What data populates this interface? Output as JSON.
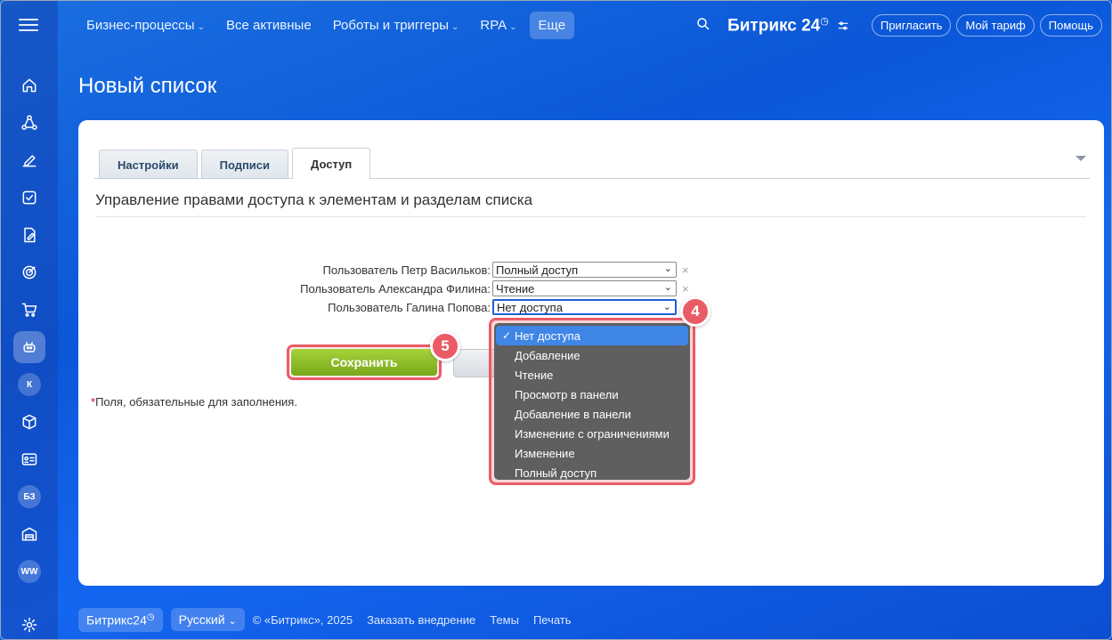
{
  "topbar": {
    "nav": [
      {
        "label": "Бизнес-процессы",
        "has_chevron": true
      },
      {
        "label": "Все активные",
        "has_chevron": false
      },
      {
        "label": "Роботы и триггеры",
        "has_chevron": true
      },
      {
        "label": "RPA",
        "has_chevron": true
      },
      {
        "label": "Еще",
        "has_chevron": false
      }
    ],
    "brand": "Битрикс 24",
    "invite_label": "Пригласить",
    "tariff_label": "Мой тариф",
    "help_label": "Помощь"
  },
  "sidebar": {
    "badges": [
      "К",
      "БЗ",
      "WW"
    ]
  },
  "page": {
    "title": "Новый список"
  },
  "tabs": [
    "Настройки",
    "Подписи",
    "Доступ"
  ],
  "access": {
    "section_title": "Управление правами доступа к элементам и разделам списка",
    "rows": [
      {
        "label": "Пользователь Петр Васильков:",
        "value": "Полный доступ"
      },
      {
        "label": "Пользователь Александра Филина:",
        "value": "Чтение"
      },
      {
        "label": "Пользователь Галина Попова:",
        "value": "Нет доступа"
      }
    ],
    "remove_symbol": "×",
    "save_label": "Сохранить",
    "required_star": "*",
    "required_note": "Поля, обязательные для заполнения."
  },
  "dropdown": {
    "selected": "Нет доступа",
    "options": [
      "Нет доступа",
      "Добавление",
      "Чтение",
      "Просмотр в панели",
      "Добавление в панели",
      "Изменение с ограничениями",
      "Изменение",
      "Полный доступ"
    ]
  },
  "annotations": {
    "step_dropdown": "4",
    "step_save": "5",
    "color": "#ea5b66"
  },
  "footer": {
    "brand_label": "Битрикс24",
    "language_label": "Русский",
    "copyright": "© «Битрикс», 2025",
    "links": [
      "Заказать внедрение",
      "Темы",
      "Печать"
    ]
  }
}
